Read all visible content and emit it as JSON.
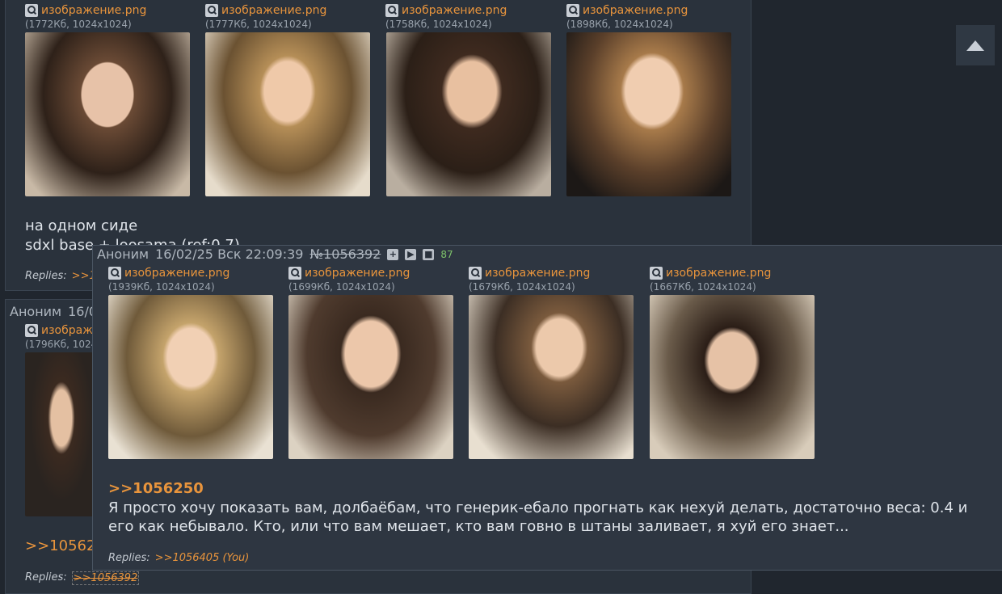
{
  "post1": {
    "files": [
      {
        "name": "изображение.png",
        "meta": "(1772Кб, 1024x1024)"
      },
      {
        "name": "изображение.png",
        "meta": "(1777Кб, 1024x1024)"
      },
      {
        "name": "изображение.png",
        "meta": "(1758Кб, 1024x1024)"
      },
      {
        "name": "изображение.png",
        "meta": "(1898Кб, 1024x1024)"
      }
    ],
    "message_line1": "на одном сиде",
    "message_line2": "sdxl base + loosama (ref:0.7)",
    "replies_label": "Replies:",
    "reply_link": ">>1056"
  },
  "post2": {
    "author": "Аноним",
    "date_partial": "16/0",
    "file_name_partial": "изображ",
    "file_meta_partial": "(1796Кб, 1024",
    "quote_partial": ">>105620",
    "replies_label": "Replies:",
    "reply_link": ">>1056392"
  },
  "preview": {
    "author": "Аноним",
    "datetime": "16/02/25 Вск 22:09:39",
    "number": "№1056392",
    "reply_count": "87",
    "files": [
      {
        "name": "изображение.png",
        "meta": "(1939Кб, 1024x1024)"
      },
      {
        "name": "изображение.png",
        "meta": "(1699Кб, 1024x1024)"
      },
      {
        "name": "изображение.png",
        "meta": "(1679Кб, 1024x1024)"
      },
      {
        "name": "изображение.png",
        "meta": "(1667Кб, 1024x1024)"
      }
    ],
    "quote": ">>1056250",
    "message": "Я просто хочу показать вам, долбаёбам, что генерик-ебало прогнать как нехуй делать, достаточно веса: 0.4 и его как небывало. Кто, или что вам мешает, кто вам говно в штаны заливает, я хуй его знает...",
    "replies_label": "Replies:",
    "reply_link": ">>1056405 (You)"
  },
  "icons": {
    "file": "magnifier-icon",
    "header_buttons": [
      "plus-icon",
      "play-icon",
      "stop-icon"
    ],
    "scroll": "chevron-up-icon"
  }
}
